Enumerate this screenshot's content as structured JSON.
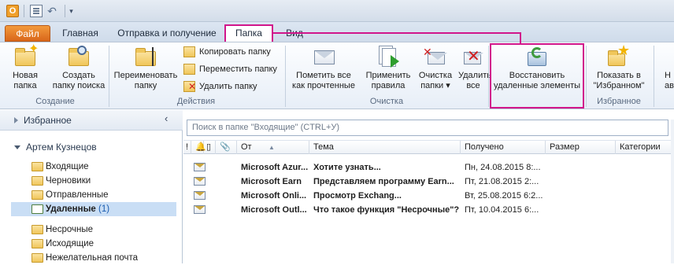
{
  "quick_access": {
    "logo_letter": "O",
    "customize_glyph": "⁄"
  },
  "tabs": [
    {
      "label": "Файл"
    },
    {
      "label": "Главная"
    },
    {
      "label": "Отправка и получение"
    },
    {
      "label": "Папка"
    },
    {
      "label": "Вид"
    }
  ],
  "ribbon": {
    "groups": [
      {
        "name": "Создание",
        "buttons": [
          {
            "label_line1": "Новая",
            "label_line2": "папка"
          },
          {
            "label_line1": "Создать",
            "label_line2": "папку поиска"
          }
        ]
      },
      {
        "name": "Действия",
        "buttons": [
          {
            "label_line1": "Переименовать",
            "label_line2": "папку"
          }
        ],
        "small_buttons": [
          {
            "label": "Копировать папку"
          },
          {
            "label": "Переместить папку"
          },
          {
            "label": "Удалить папку"
          }
        ]
      },
      {
        "name": "Очистка",
        "buttons": [
          {
            "label_line1": "Пометить все",
            "label_line2": "как прочтенные"
          },
          {
            "label_line1": "Применить",
            "label_line2": "правила"
          },
          {
            "label_line1": "Очистка",
            "label_line2": "папки"
          },
          {
            "label_line1": "Удалить",
            "label_line2": "все"
          }
        ]
      },
      {
        "name": "",
        "buttons": [
          {
            "label_line1": "Восстановить",
            "label_line2": "удаленные элементы"
          }
        ]
      },
      {
        "name": "Избранное",
        "buttons": [
          {
            "label_line1": "Показать в",
            "label_line2": "\"Избранном\""
          }
        ]
      },
      {
        "name": "",
        "buttons": [
          {
            "label_line1": "Н",
            "label_line2": "авто"
          }
        ]
      }
    ]
  },
  "nav": {
    "favorites_label": "Избранное",
    "collapse_glyph": "‹",
    "account": "Артем Кузнецов",
    "folders": [
      {
        "label": "Входящие",
        "count": ""
      },
      {
        "label": "Черновики",
        "count": ""
      },
      {
        "label": "Отправленные",
        "count": ""
      },
      {
        "label": "Удаленные",
        "count": "(1)"
      },
      {
        "label": "Несрочные",
        "count": ""
      },
      {
        "label": "Исходящие",
        "count": ""
      },
      {
        "label": "Нежелательная почта",
        "count": ""
      }
    ]
  },
  "mail": {
    "search_placeholder": "Поиск в папке \"Входящие\" (CTRL+У)",
    "columns": {
      "importance": "!",
      "from": "От",
      "subject": "Тема",
      "received": "Получено",
      "size": "Размер",
      "categories": "Категории"
    },
    "rows": [
      {
        "from": "Microsoft Azur...",
        "subject": "Хотите узнать...",
        "received": "Пн, 24.08.2015 8:..."
      },
      {
        "from": "Microsoft Earn",
        "subject": "Представляем программу Earn...",
        "received": "Пт, 21.08.2015 2:..."
      },
      {
        "from": "Microsoft Onli...",
        "subject": "Просмотр Exchang...",
        "received": "Вт, 25.08.2015 6:2..."
      },
      {
        "from": "Microsoft Outl...",
        "subject": "Что такое функция \"Несрочные\"?",
        "received": "Пт, 10.04.2015 6:..."
      }
    ]
  },
  "colors": {
    "highlight": "#d1168b",
    "file_tab": "#e57b24",
    "selected_folder": "#c9def5"
  }
}
